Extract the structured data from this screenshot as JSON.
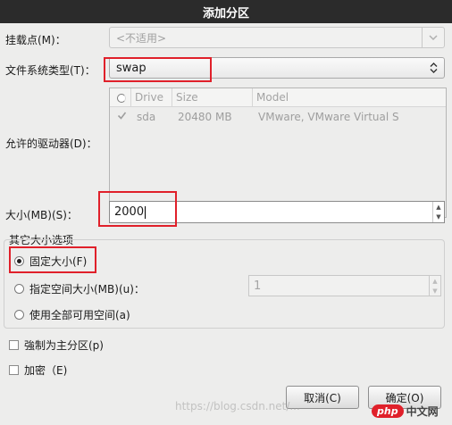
{
  "window": {
    "title": "添加分区"
  },
  "mount_point": {
    "label": "挂载点(M)：",
    "value": "<不适用>"
  },
  "fs_type": {
    "label": "文件系统类型(T)：",
    "value": "swap"
  },
  "drives": {
    "label": "允许的驱动器(D)：",
    "columns": [
      "Drive",
      "Size",
      "Model"
    ],
    "rows": [
      {
        "drive": "sda",
        "size": "20480 MB",
        "model": "VMware, VMware Virtual S"
      }
    ]
  },
  "size": {
    "label": "大小(MB)(S)：",
    "value": "2000"
  },
  "size_options": {
    "legend": "其它大小选项",
    "fixed": "固定大小(F)",
    "up_to": "指定空间大小(MB)(u)：",
    "up_to_value": "1",
    "fill_all": "使用全部可用空间(a)"
  },
  "primary": {
    "label": "強制为主分区(p)"
  },
  "encrypt": {
    "label": "加密（E)"
  },
  "buttons": {
    "cancel": "取消(C)",
    "ok": "确定(O)"
  },
  "watermark": {
    "text": "https://blog.csdn.net/...",
    "logo_text": "php",
    "logo_cn": "中文网"
  },
  "colors": {
    "highlight": "#e0202a",
    "titlebar": "#2b2b2b"
  }
}
